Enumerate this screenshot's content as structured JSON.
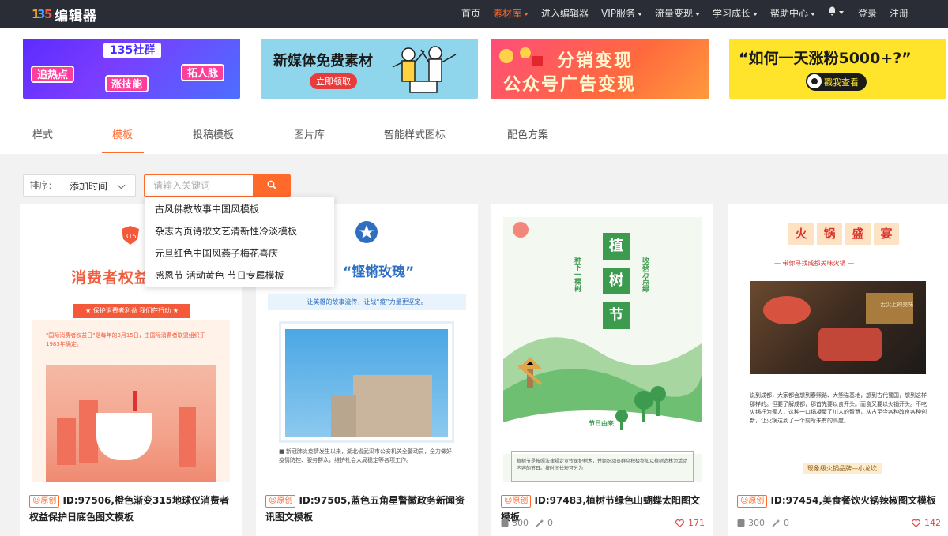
{
  "brand": {
    "logo_text": "135",
    "name": "编辑器"
  },
  "nav": [
    {
      "label": "首页",
      "active": false,
      "caret": false
    },
    {
      "label": "素材库",
      "active": true,
      "caret": true
    },
    {
      "label": "进入编辑器",
      "active": false,
      "caret": false
    },
    {
      "label": "VIP服务",
      "active": false,
      "caret": true
    },
    {
      "label": "流量变现",
      "active": false,
      "caret": true
    },
    {
      "label": "学习成长",
      "active": false,
      "caret": true
    },
    {
      "label": "帮助中心",
      "active": false,
      "caret": true
    },
    {
      "label": "",
      "icon": "bell-icon",
      "caret": true
    },
    {
      "label": "登录",
      "active": false,
      "caret": false
    },
    {
      "label": "注册",
      "active": false,
      "caret": false
    }
  ],
  "banners": {
    "b1": {
      "top": "135社群",
      "pills": [
        "追热点",
        "涨技能",
        "拓人脉"
      ]
    },
    "b2": {
      "title": "新媒体免费素材",
      "button": "立即领取"
    },
    "b3": {
      "line1": "分销变现",
      "line2": "公众号广告变现"
    },
    "b4": {
      "title": "“如何一天涨粉5000+?”",
      "button": "戳我查看"
    }
  },
  "tabs": [
    "样式",
    "模板",
    "投稿模板",
    "图片库",
    "智能样式图标",
    "配色方案"
  ],
  "filter": {
    "sort_label": "排序:",
    "sort_value": "添加时间",
    "search_placeholder": "请输入关键词"
  },
  "suggestions": [
    "古风佛教故事中国风模板",
    "杂志内页诗歌文艺清新性冷淡模板",
    "元旦红色中国风燕子梅花喜庆",
    "感恩节 活动黄色 节日专属模板"
  ],
  "cards": [
    {
      "badge": "原创",
      "title": "ID:97506,橙色渐变315地球仪消费者权益保护日底色图文模板",
      "views": "",
      "uses": "",
      "likes": "",
      "thumb": {
        "heading": "消费者权益",
        "ribbon": "★ 保护消费者利益 我们在行动 ★",
        "para": "\"国际消费者权益日\"是每年的3月15日，由国际消费者联盟组织于1983年确定。"
      }
    },
    {
      "badge": "原创",
      "title": "ID:97505,蓝色五角星警徽政务新闻资讯图文模板",
      "views": "",
      "uses": "",
      "likes": "",
      "thumb": {
        "heading": "“铿锵玫瑰”",
        "sub": "让英雄的故事流传，让战“疫”力量更坚定。",
        "para": "■ 新冠肺炎疫情发生以来，湖北省武汉市公安机关全警动员，全力做好疫情防控、服务群众，维护社会大局稳定等各项工作。"
      }
    },
    {
      "badge": "原创",
      "title": "ID:97483,植树节绿色山蝴蝶太阳图文模板",
      "views": "300",
      "uses": "0",
      "likes": "171",
      "thumb": {
        "chars": [
          "植",
          "树",
          "节"
        ],
        "left_vertical": "种下一棵树",
        "right_vertical": "收获万点绿",
        "label": "节日由来",
        "footer": "植树节是按照法律规定宣传保护树木，并组织动员群众积极参加以植树造林为活动内容的节日。按时间长短可分为"
      }
    },
    {
      "badge": "原创",
      "title": "ID:97454,美食餐饮火锅辣椒图文模板",
      "views": "300",
      "uses": "0",
      "likes": "142",
      "thumb": {
        "chars": [
          "火",
          "锅",
          "盛",
          "宴"
        ],
        "sub": "— 带你寻找成都美味火锅 —",
        "caption": "—— 舌尖上的美味",
        "para": "说到成都，大家都会想到春熙路、大熊猫基地，想到古代蜀国，想到这样那样的。但要了解成都，那首先要以食开头。而食又要以火锅开头。不吃火锅枉为蜀人，这种一口锅凝聚了川人的智慧，从古至今各种改良各种创新，让火锅达到了一个前所未有的高度。",
        "tag": "现象级火锅品牌—小龙坎"
      }
    }
  ],
  "colors": {
    "accent": "#ff6a2b",
    "topbar": "#2a2d35",
    "like": "#e04747"
  }
}
